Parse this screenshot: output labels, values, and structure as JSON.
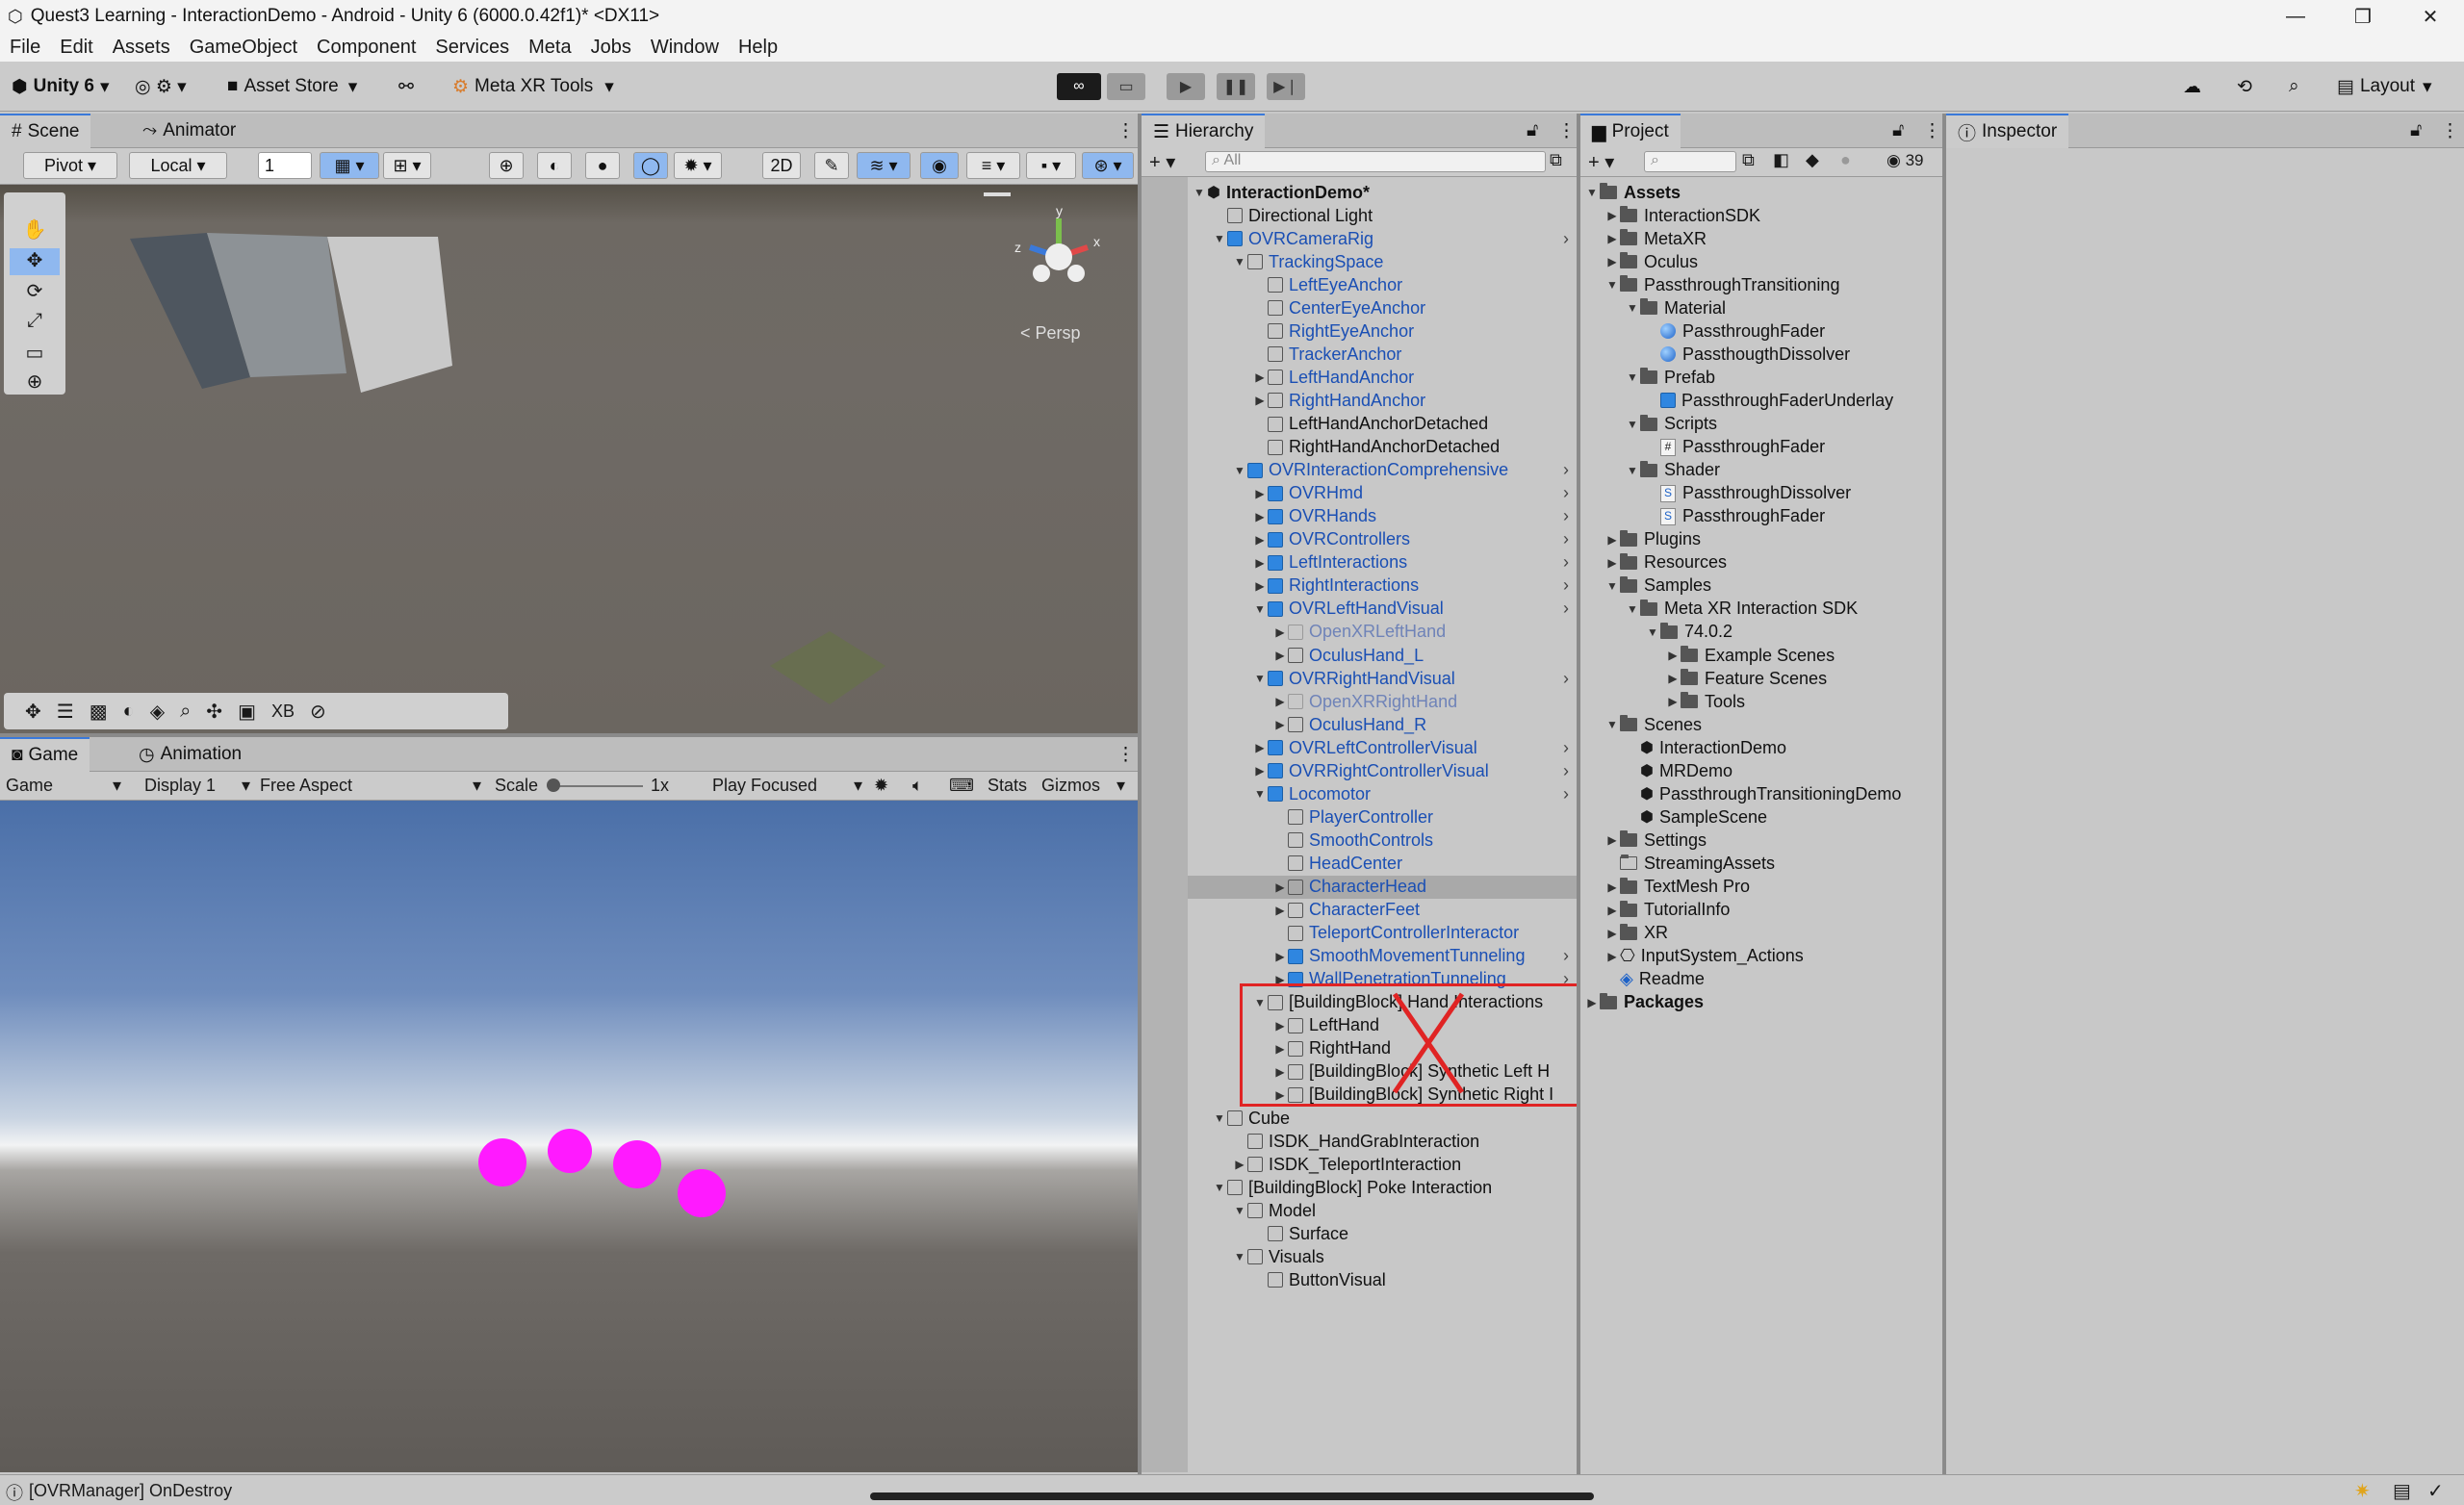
{
  "window": {
    "title": "Quest3 Learning - InteractionDemo - Android - Unity 6 (6000.0.42f1)* <DX11>"
  },
  "menu": [
    "File",
    "Edit",
    "Assets",
    "GameObject",
    "Component",
    "Services",
    "Meta",
    "Jobs",
    "Window",
    "Help"
  ],
  "toolbar": {
    "account": "Unity 6",
    "asset_store": "Asset Store",
    "meta_tools": "Meta XR Tools",
    "layout": "Layout"
  },
  "scene": {
    "tab_scene": "Scene",
    "tab_animator": "Animator",
    "pivot": "Pivot",
    "local": "Local",
    "grid_value": "1",
    "persp": "< Persp"
  },
  "game": {
    "tab_game": "Game",
    "tab_animation": "Animation",
    "game_dropdown": "Game",
    "display": "Display 1",
    "aspect": "Free Aspect",
    "scale_label": "Scale",
    "scale_value": "1x",
    "play_focused": "Play Focused",
    "stats": "Stats",
    "gizmos": "Gizmos"
  },
  "overlay": {
    "xb": "XB"
  },
  "hierarchy": {
    "tab": "Hierarchy",
    "search_placeholder": "All",
    "items": [
      {
        "label": "InteractionDemo*",
        "indent": 0,
        "tri": "▼",
        "icon": "scene",
        "style": "bold"
      },
      {
        "label": "Directional Light",
        "indent": 1,
        "tri": "",
        "icon": "cube",
        "style": ""
      },
      {
        "label": "OVRCameraRig",
        "indent": 1,
        "tri": "▼",
        "icon": "blue",
        "style": "prefab",
        "arrow": true
      },
      {
        "label": "TrackingSpace",
        "indent": 2,
        "tri": "▼",
        "icon": "cube",
        "style": "prefab"
      },
      {
        "label": "LeftEyeAnchor",
        "indent": 3,
        "tri": "",
        "icon": "cube",
        "style": "prefab"
      },
      {
        "label": "CenterEyeAnchor",
        "indent": 3,
        "tri": "",
        "icon": "cube",
        "style": "prefab"
      },
      {
        "label": "RightEyeAnchor",
        "indent": 3,
        "tri": "",
        "icon": "cube",
        "style": "prefab"
      },
      {
        "label": "TrackerAnchor",
        "indent": 3,
        "tri": "",
        "icon": "cube",
        "style": "prefab"
      },
      {
        "label": "LeftHandAnchor",
        "indent": 3,
        "tri": "▶",
        "icon": "cube",
        "style": "prefab"
      },
      {
        "label": "RightHandAnchor",
        "indent": 3,
        "tri": "▶",
        "icon": "cube",
        "style": "prefab"
      },
      {
        "label": "LeftHandAnchorDetached",
        "indent": 3,
        "tri": "",
        "icon": "cube",
        "style": ""
      },
      {
        "label": "RightHandAnchorDetached",
        "indent": 3,
        "tri": "",
        "icon": "cube",
        "style": ""
      },
      {
        "label": "OVRInteractionComprehensive",
        "indent": 2,
        "tri": "▼",
        "icon": "blue",
        "style": "prefab",
        "arrow": true
      },
      {
        "label": "OVRHmd",
        "indent": 3,
        "tri": "▶",
        "icon": "blue",
        "style": "prefab",
        "arrow": true
      },
      {
        "label": "OVRHands",
        "indent": 3,
        "tri": "▶",
        "icon": "blue",
        "style": "prefab",
        "arrow": true
      },
      {
        "label": "OVRControllers",
        "indent": 3,
        "tri": "▶",
        "icon": "blue",
        "style": "prefab",
        "arrow": true
      },
      {
        "label": "LeftInteractions",
        "indent": 3,
        "tri": "▶",
        "icon": "blue",
        "style": "prefab",
        "arrow": true
      },
      {
        "label": "RightInteractions",
        "indent": 3,
        "tri": "▶",
        "icon": "blue",
        "style": "prefab",
        "arrow": true
      },
      {
        "label": "OVRLeftHandVisual",
        "indent": 3,
        "tri": "▼",
        "icon": "blue",
        "style": "prefab",
        "arrow": true
      },
      {
        "label": "OpenXRLeftHand",
        "indent": 4,
        "tri": "▶",
        "icon": "faded",
        "style": "faded"
      },
      {
        "label": "OculusHand_L",
        "indent": 4,
        "tri": "▶",
        "icon": "cube",
        "style": "prefab"
      },
      {
        "label": "OVRRightHandVisual",
        "indent": 3,
        "tri": "▼",
        "icon": "blue",
        "style": "prefab",
        "arrow": true
      },
      {
        "label": "OpenXRRightHand",
        "indent": 4,
        "tri": "▶",
        "icon": "faded",
        "style": "faded"
      },
      {
        "label": "OculusHand_R",
        "indent": 4,
        "tri": "▶",
        "icon": "cube",
        "style": "prefab"
      },
      {
        "label": "OVRLeftControllerVisual",
        "indent": 3,
        "tri": "▶",
        "icon": "blue",
        "style": "prefab",
        "arrow": true
      },
      {
        "label": "OVRRightControllerVisual",
        "indent": 3,
        "tri": "▶",
        "icon": "blue",
        "style": "prefab",
        "arrow": true
      },
      {
        "label": "Locomotor",
        "indent": 3,
        "tri": "▼",
        "icon": "blue",
        "style": "prefab",
        "arrow": true
      },
      {
        "label": "PlayerController",
        "indent": 4,
        "tri": "",
        "icon": "cube",
        "style": "prefab"
      },
      {
        "label": "SmoothControls",
        "indent": 4,
        "tri": "",
        "icon": "cube",
        "style": "prefab"
      },
      {
        "label": "HeadCenter",
        "indent": 4,
        "tri": "",
        "icon": "cube",
        "style": "prefab"
      },
      {
        "label": "CharacterHead",
        "indent": 4,
        "tri": "▶",
        "icon": "cube",
        "style": "prefab",
        "selected": true
      },
      {
        "label": "CharacterFeet",
        "indent": 4,
        "tri": "▶",
        "icon": "cube",
        "style": "prefab"
      },
      {
        "label": "TeleportControllerInteractor",
        "indent": 4,
        "tri": "",
        "icon": "cube",
        "style": "prefab"
      },
      {
        "label": "SmoothMovementTunneling",
        "indent": 4,
        "tri": "▶",
        "icon": "blue",
        "style": "prefab",
        "arrow": true
      },
      {
        "label": "WallPenetrationTunneling",
        "indent": 4,
        "tri": "▶",
        "icon": "blue",
        "style": "prefab",
        "arrow": true
      },
      {
        "label": "[BuildingBlock] Hand Interactions",
        "indent": 3,
        "tri": "▼",
        "icon": "cube",
        "style": ""
      },
      {
        "label": "LeftHand",
        "indent": 4,
        "tri": "▶",
        "icon": "cube",
        "style": ""
      },
      {
        "label": "RightHand",
        "indent": 4,
        "tri": "▶",
        "icon": "cube",
        "style": ""
      },
      {
        "label": "[BuildingBlock] Synthetic Left H",
        "indent": 4,
        "tri": "▶",
        "icon": "cube",
        "style": ""
      },
      {
        "label": "[BuildingBlock] Synthetic Right I",
        "indent": 4,
        "tri": "▶",
        "icon": "cube",
        "style": ""
      },
      {
        "label": "Cube",
        "indent": 1,
        "tri": "▼",
        "icon": "cube",
        "style": ""
      },
      {
        "label": "ISDK_HandGrabInteraction",
        "indent": 2,
        "tri": "",
        "icon": "cube",
        "style": ""
      },
      {
        "label": "ISDK_TeleportInteraction",
        "indent": 2,
        "tri": "▶",
        "icon": "cube",
        "style": ""
      },
      {
        "label": "[BuildingBlock] Poke Interaction",
        "indent": 1,
        "tri": "▼",
        "icon": "cube",
        "style": ""
      },
      {
        "label": "Model",
        "indent": 2,
        "tri": "▼",
        "icon": "cube",
        "style": ""
      },
      {
        "label": "Surface",
        "indent": 3,
        "tri": "",
        "icon": "cube",
        "style": ""
      },
      {
        "label": "Visuals",
        "indent": 2,
        "tri": "▼",
        "icon": "cube",
        "style": ""
      },
      {
        "label": "ButtonVisual",
        "indent": 3,
        "tri": "",
        "icon": "cube",
        "style": ""
      }
    ]
  },
  "project": {
    "tab": "Project",
    "count": "39",
    "items": [
      {
        "label": "Assets",
        "indent": 0,
        "tri": "▼",
        "icon": "folder",
        "style": "bold"
      },
      {
        "label": "InteractionSDK",
        "indent": 1,
        "tri": "▶",
        "icon": "folder",
        "style": ""
      },
      {
        "label": "MetaXR",
        "indent": 1,
        "tri": "▶",
        "icon": "folder",
        "style": ""
      },
      {
        "label": "Oculus",
        "indent": 1,
        "tri": "▶",
        "icon": "folder",
        "style": ""
      },
      {
        "label": "PassthroughTransitioning",
        "indent": 1,
        "tri": "▼",
        "icon": "folder",
        "style": ""
      },
      {
        "label": "Material",
        "indent": 2,
        "tri": "▼",
        "icon": "folder",
        "style": ""
      },
      {
        "label": "PassthroughFader",
        "indent": 3,
        "tri": "",
        "icon": "material",
        "style": ""
      },
      {
        "label": "PassthougthDissolver",
        "indent": 3,
        "tri": "",
        "icon": "material",
        "style": ""
      },
      {
        "label": "Prefab",
        "indent": 2,
        "tri": "▼",
        "icon": "folder",
        "style": ""
      },
      {
        "label": "PassthroughFaderUnderlay",
        "indent": 3,
        "tri": "",
        "icon": "blue",
        "style": ""
      },
      {
        "label": "Scripts",
        "indent": 2,
        "tri": "▼",
        "icon": "folder",
        "style": ""
      },
      {
        "label": "PassthroughFader",
        "indent": 3,
        "tri": "",
        "icon": "script",
        "style": ""
      },
      {
        "label": "Shader",
        "indent": 2,
        "tri": "▼",
        "icon": "folder",
        "style": ""
      },
      {
        "label": "PassthroughDissolver",
        "indent": 3,
        "tri": "",
        "icon": "shader",
        "style": ""
      },
      {
        "label": "PassthroughFader",
        "indent": 3,
        "tri": "",
        "icon": "shader",
        "style": ""
      },
      {
        "label": "Plugins",
        "indent": 1,
        "tri": "▶",
        "icon": "folder",
        "style": ""
      },
      {
        "label": "Resources",
        "indent": 1,
        "tri": "▶",
        "icon": "folder",
        "style": ""
      },
      {
        "label": "Samples",
        "indent": 1,
        "tri": "▼",
        "icon": "folder",
        "style": ""
      },
      {
        "label": "Meta XR Interaction SDK",
        "indent": 2,
        "tri": "▼",
        "icon": "folder",
        "style": ""
      },
      {
        "label": "74.0.2",
        "indent": 3,
        "tri": "▼",
        "icon": "folder",
        "style": ""
      },
      {
        "label": "Example Scenes",
        "indent": 4,
        "tri": "▶",
        "icon": "folder",
        "style": ""
      },
      {
        "label": "Feature Scenes",
        "indent": 4,
        "tri": "▶",
        "icon": "folder",
        "style": ""
      },
      {
        "label": "Tools",
        "indent": 4,
        "tri": "▶",
        "icon": "folder",
        "style": ""
      },
      {
        "label": "Scenes",
        "indent": 1,
        "tri": "▼",
        "icon": "folder",
        "style": ""
      },
      {
        "label": "InteractionDemo",
        "indent": 2,
        "tri": "",
        "icon": "scene",
        "style": ""
      },
      {
        "label": "MRDemo",
        "indent": 2,
        "tri": "",
        "icon": "scene",
        "style": ""
      },
      {
        "label": "PassthroughTransitioningDemo",
        "indent": 2,
        "tri": "",
        "icon": "scene",
        "style": ""
      },
      {
        "label": "SampleScene",
        "indent": 2,
        "tri": "",
        "icon": "scene",
        "style": ""
      },
      {
        "label": "Settings",
        "indent": 1,
        "tri": "▶",
        "icon": "folder",
        "style": ""
      },
      {
        "label": "StreamingAssets",
        "indent": 1,
        "tri": "",
        "icon": "folderempty",
        "style": ""
      },
      {
        "label": "TextMesh Pro",
        "indent": 1,
        "tri": "▶",
        "icon": "folder",
        "style": ""
      },
      {
        "label": "TutorialInfo",
        "indent": 1,
        "tri": "▶",
        "icon": "folder",
        "style": ""
      },
      {
        "label": "XR",
        "indent": 1,
        "tri": "▶",
        "icon": "folder",
        "style": ""
      },
      {
        "label": "InputSystem_Actions",
        "indent": 1,
        "tri": "▶",
        "icon": "input",
        "style": ""
      },
      {
        "label": "Readme",
        "indent": 1,
        "tri": "",
        "icon": "readme",
        "style": ""
      },
      {
        "label": "Packages",
        "indent": 0,
        "tri": "▶",
        "icon": "folder",
        "style": "bold"
      }
    ]
  },
  "inspector": {
    "tab": "Inspector"
  },
  "status": {
    "message": "[OVRManager] OnDestroy"
  },
  "colors": {
    "accent": "#3a79d9",
    "annotation_red": "#e02424",
    "sphere_magenta": "#ff1aff"
  }
}
